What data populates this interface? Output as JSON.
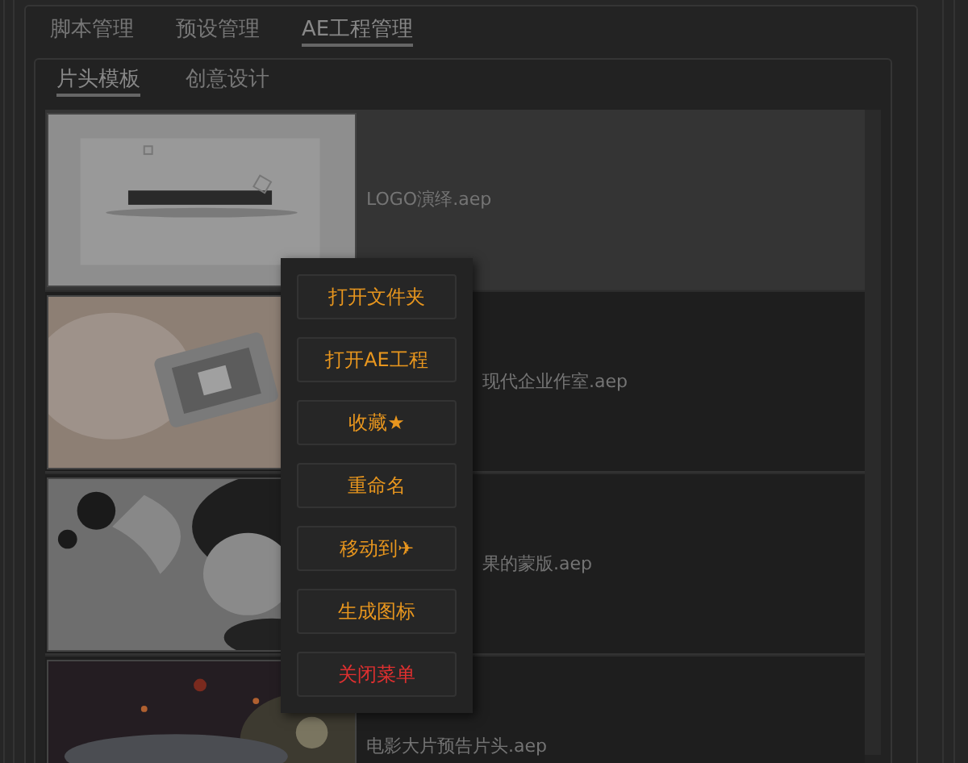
{
  "tabs": [
    {
      "label": "脚本管理",
      "selected": false
    },
    {
      "label": "预设管理",
      "selected": false
    },
    {
      "label": "AE工程管理",
      "selected": true
    }
  ],
  "sub_tabs": [
    {
      "label": "片头模板",
      "selected": true
    },
    {
      "label": "创意设计",
      "selected": false
    }
  ],
  "files": [
    {
      "name": "LOGO演绎.aep",
      "selected": true,
      "kind": "picture"
    },
    {
      "name": "现代企业作室.aep",
      "selected": false,
      "kind": "picture"
    },
    {
      "name": "果的蒙版.aep",
      "selected": false,
      "kind": "picture"
    },
    {
      "name": "电影大片预告片头.aep",
      "selected": false,
      "kind": "picture"
    }
  ],
  "context_menu": [
    {
      "label": "打开文件夹",
      "kind": "action"
    },
    {
      "label": "打开AE工程",
      "kind": "action"
    },
    {
      "label": "收藏★",
      "kind": "action"
    },
    {
      "label": "重命名",
      "kind": "action"
    },
    {
      "label": "移动到✈",
      "kind": "action"
    },
    {
      "label": "生成图标",
      "kind": "action"
    },
    {
      "label": "关闭菜单",
      "kind": "close"
    }
  ]
}
